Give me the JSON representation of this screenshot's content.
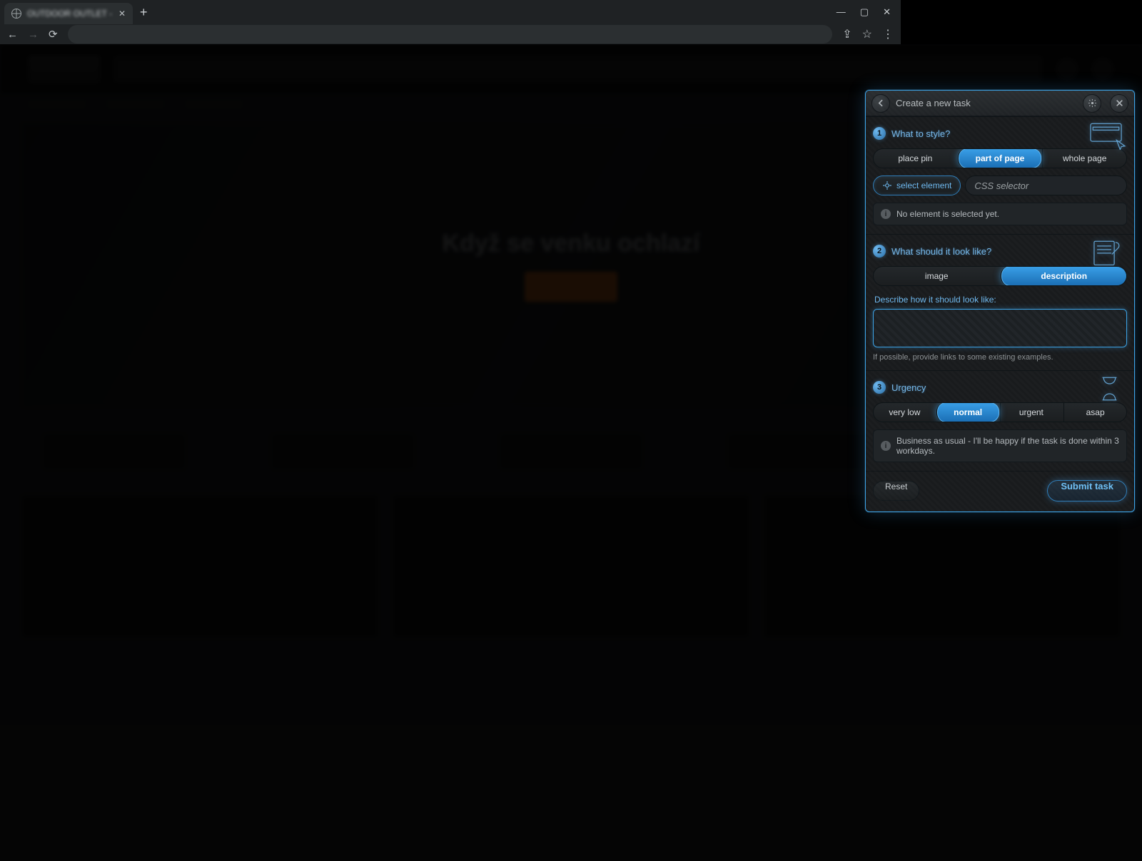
{
  "browser": {
    "tab_title": "OUTDOOR OUTLET - outlet st…",
    "window_controls": {
      "min": "—",
      "max": "▢",
      "close": "✕"
    }
  },
  "panel": {
    "title": "Create a new task",
    "step1": {
      "title": "What to style?",
      "options": [
        "place pin",
        "part of page",
        "whole page"
      ],
      "selected": "part of page",
      "select_element": "select element",
      "css_placeholder": "CSS selector",
      "empty_msg": "No element is selected yet."
    },
    "step2": {
      "title": "What should it look like?",
      "options": [
        "image",
        "description"
      ],
      "selected": "description",
      "field_label": "Describe how it should look like:",
      "value": "",
      "hint": "If possible, provide links to some existing examples."
    },
    "step3": {
      "title": "Urgency",
      "options": [
        "very low",
        "normal",
        "urgent",
        "asap"
      ],
      "selected": "normal",
      "info": "Business as usual - I'll be happy if the task is done within 3 workdays."
    },
    "footer": {
      "reset": "Reset",
      "submit": "Submit task"
    }
  }
}
